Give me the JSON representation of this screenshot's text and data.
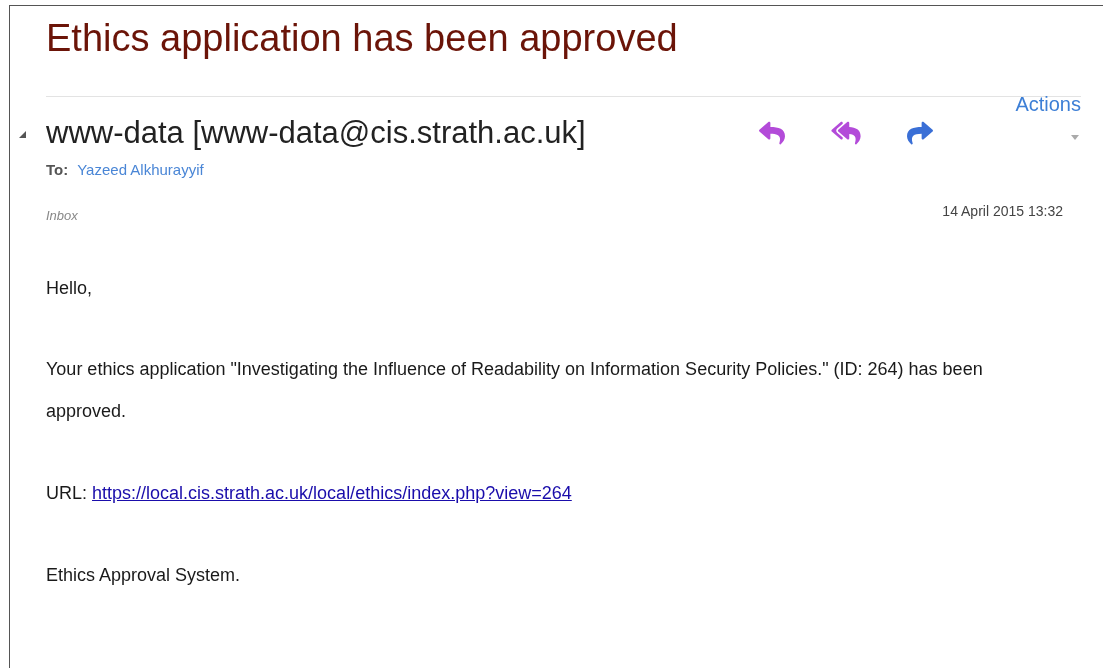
{
  "subject": "Ethics application has been approved",
  "actions_label": "Actions",
  "sender": "www-data [www-data@cis.strath.ac.uk]",
  "to": {
    "label": "To:",
    "name": "Yazeed Alkhurayyif"
  },
  "folder": "Inbox",
  "date": "14 April 2015 13:32",
  "body": {
    "greeting": "Hello,",
    "paragraph": "Your ethics application \"Investigating the Influence of Readability on Information Security Policies.\" (ID: 264) has been approved.",
    "url_label": "URL:",
    "url": "https://local.cis.strath.ac.uk/local/ethics/index.php?view=264",
    "signature": "Ethics Approval System."
  }
}
